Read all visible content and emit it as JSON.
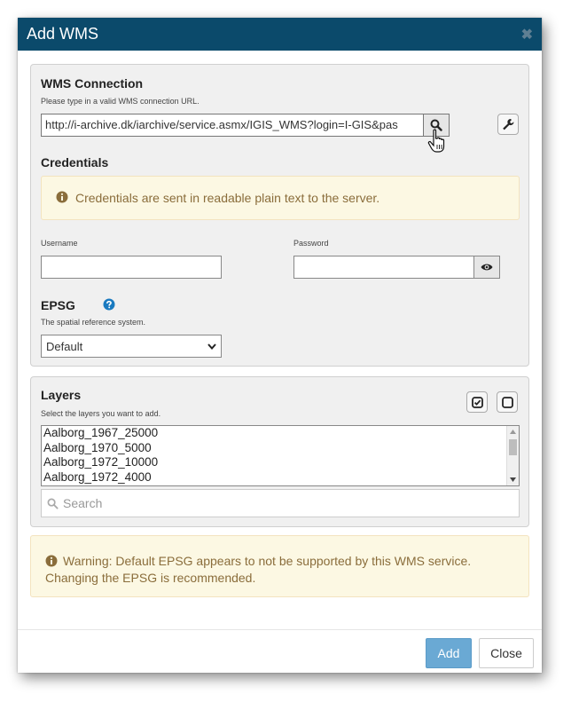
{
  "dialog": {
    "title": "Add WMS",
    "close_icon": "times-icon"
  },
  "connection": {
    "heading": "WMS Connection",
    "hint": "Please type in a valid WMS connection URL.",
    "url_value": "http://i-archive.dk/iarchive/service.asmx/IGIS_WMS?login=I-GIS&pas",
    "search_icon": "search-icon",
    "settings_icon": "wrench-icon"
  },
  "credentials": {
    "heading": "Credentials",
    "alert": "Credentials are sent in readable plain text to the server.",
    "username_label": "Username",
    "username_value": "",
    "password_label": "Password",
    "password_value": ""
  },
  "epsg": {
    "heading": "EPSG",
    "hint": "The spatial reference system.",
    "selected": "Default"
  },
  "layers": {
    "heading": "Layers",
    "hint": "Select the layers you want to add.",
    "items": [
      "Aalborg_1967_25000",
      "Aalborg_1970_5000",
      "Aalborg_1972_10000",
      "Aalborg_1972_4000"
    ],
    "search_placeholder": "Search"
  },
  "warning": {
    "line1": "Warning: Default EPSG appears to not be supported by this WMS service.",
    "line2": "Changing the EPSG is recommended."
  },
  "footer": {
    "add_label": "Add",
    "close_label": "Close"
  },
  "colors": {
    "titlebar": "#0b4a6b",
    "primary_button": "#6aa9d4",
    "alert_bg": "#fcf8e3",
    "alert_text": "#8a6d3b",
    "help_icon": "#1a7ac0"
  }
}
